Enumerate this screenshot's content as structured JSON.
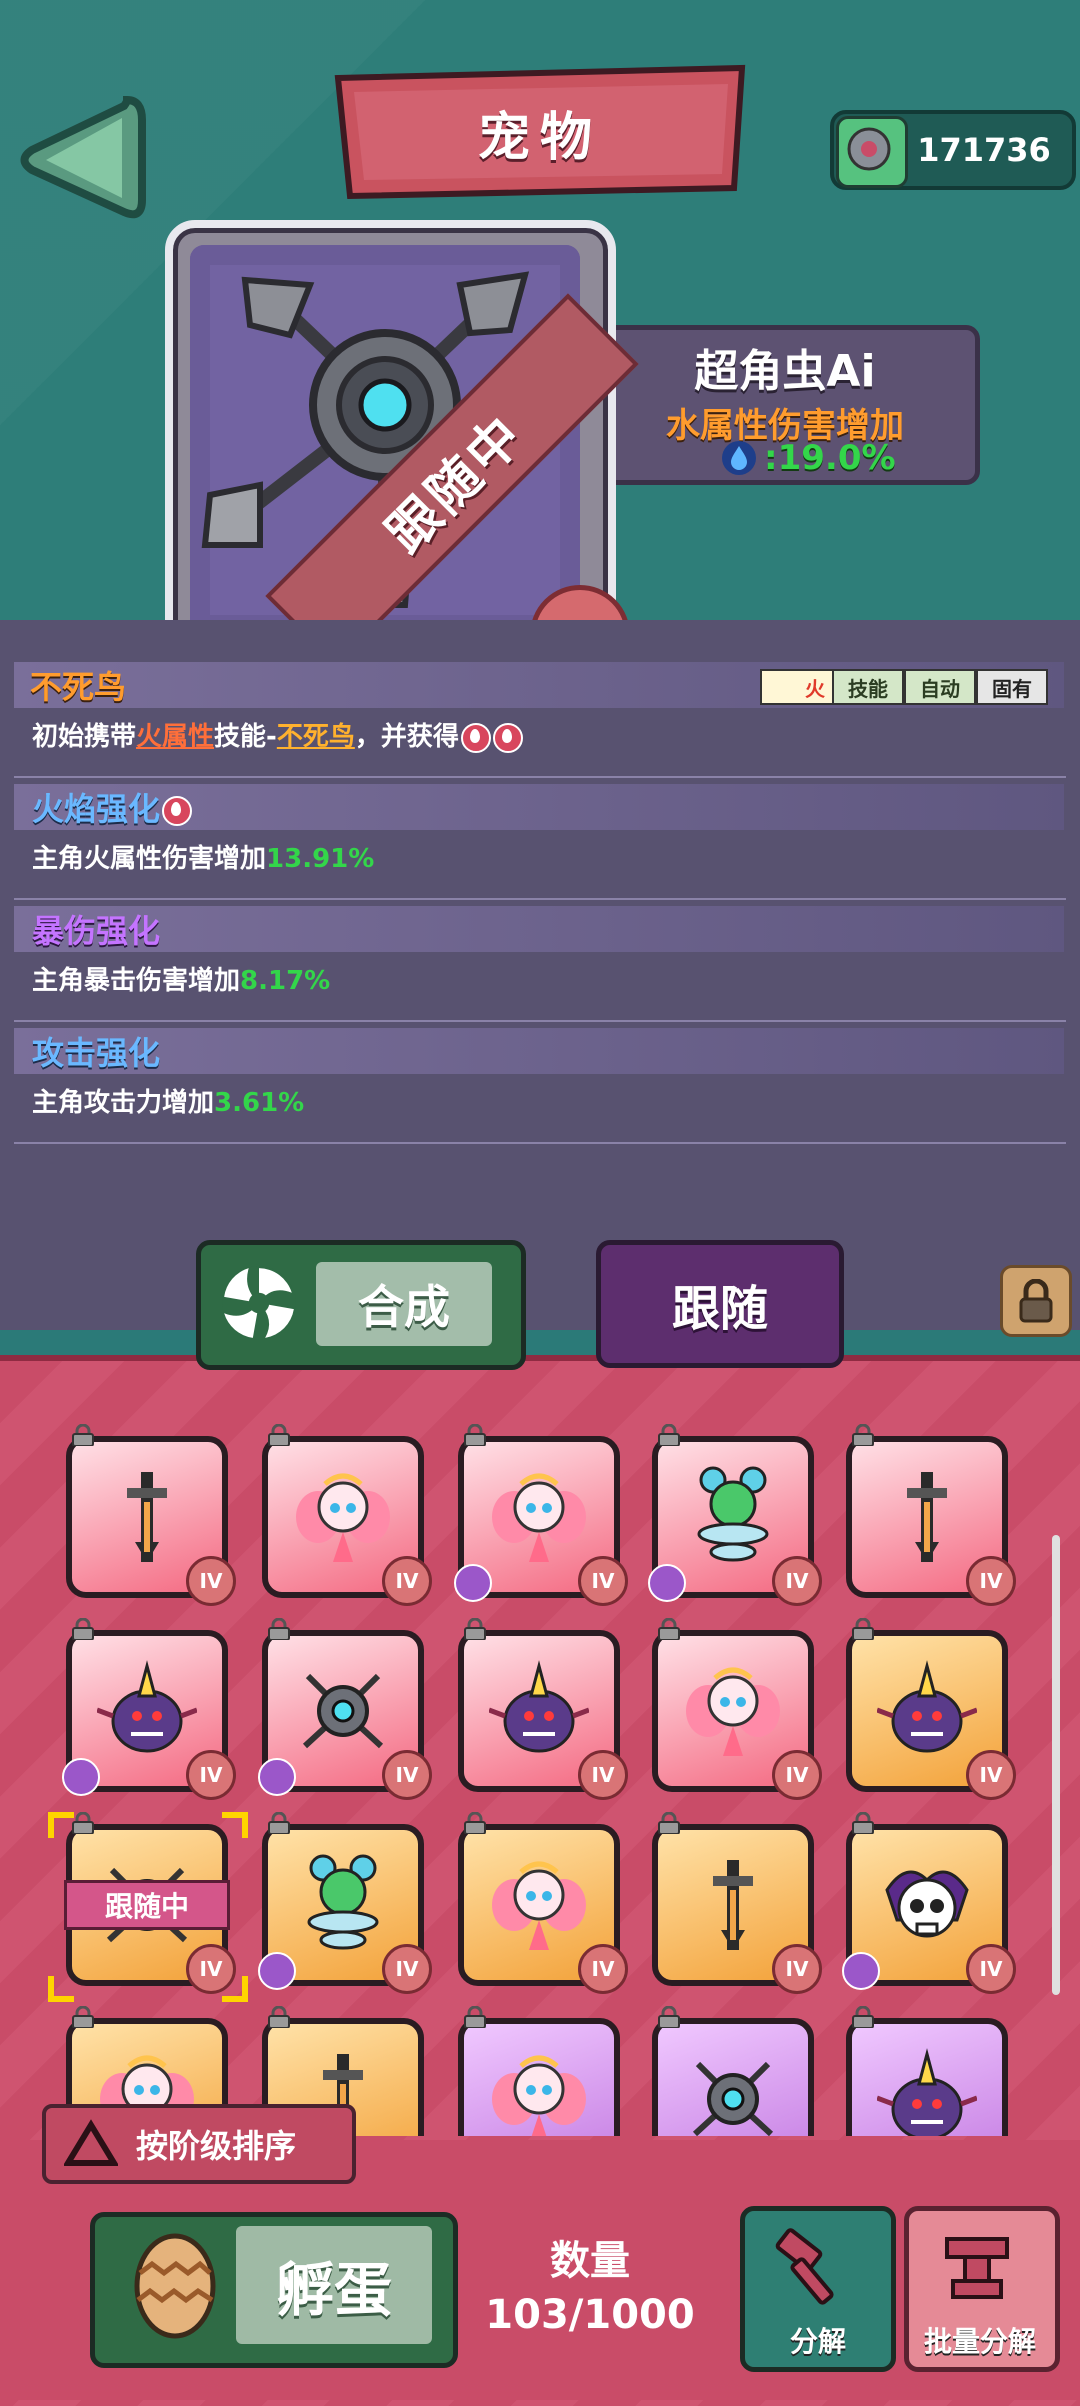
{
  "header": {
    "title": "宠物",
    "currency_value": "171736"
  },
  "pet": {
    "name": "超角虫Ai",
    "attribute": "水属性伤害增加",
    "bonus": ":19.0%",
    "follow_ribbon": "跟随中",
    "tier": "IV"
  },
  "skills": [
    {
      "title": "不死鸟",
      "desc_prefix": "初始携带",
      "desc_hl1": "火属性",
      "desc_mid": "技能-",
      "desc_hl2": "不死鸟",
      "desc_suffix": "，并获得"
    },
    {
      "title": "火焰强化",
      "desc": "主角火属性伤害增加",
      "value": "13.91%"
    },
    {
      "title": "暴伤强化",
      "desc": "主角暴击伤害增加",
      "value": "8.17%"
    },
    {
      "title": "攻击强化",
      "desc": "主角攻击力增加",
      "value": "3.61%"
    }
  ],
  "tags": [
    "火",
    "技能",
    "自动",
    "固有"
  ],
  "tabs": {
    "merge": "合成",
    "follow": "跟随"
  },
  "grid": {
    "level": "IV",
    "follow_tag": "跟随中",
    "slots": [
      {
        "pet": "sword-pet",
        "bg": "red",
        "elem": false
      },
      {
        "pet": "fairy-pet",
        "bg": "red",
        "elem": false
      },
      {
        "pet": "fairy-pet",
        "bg": "red",
        "elem": true
      },
      {
        "pet": "tornado-pet",
        "bg": "red",
        "elem": true
      },
      {
        "pet": "sword-pet",
        "bg": "red",
        "elem": false
      },
      {
        "pet": "horn-bug-pet",
        "bg": "red",
        "elem": true
      },
      {
        "pet": "orb-bug-pet",
        "bg": "red",
        "elem": true
      },
      {
        "pet": "horn-bug-pet",
        "bg": "red",
        "elem": false
      },
      {
        "pet": "fairy-pet",
        "bg": "red",
        "elem": false
      },
      {
        "pet": "horn-bug-pet",
        "bg": "orange",
        "elem": false
      },
      {
        "pet": "orb-bug-pet",
        "bg": "orange",
        "elem": false,
        "following": true
      },
      {
        "pet": "tornado-pet",
        "bg": "orange",
        "elem": true
      },
      {
        "pet": "fairy-pet",
        "bg": "orange",
        "elem": false
      },
      {
        "pet": "sword-pet",
        "bg": "orange",
        "elem": false
      },
      {
        "pet": "skull-pet",
        "bg": "orange",
        "elem": true
      },
      {
        "pet": "fairy-pet",
        "bg": "orange",
        "elem": false
      },
      {
        "pet": "sword-pet",
        "bg": "orange",
        "elem": false
      },
      {
        "pet": "fairy-pet",
        "bg": "purple",
        "elem": false
      },
      {
        "pet": "orb-bug-pet",
        "bg": "purple",
        "elem": false
      },
      {
        "pet": "horn-bug-pet",
        "bg": "purple",
        "elem": false
      }
    ]
  },
  "sort_label": "按阶级排序",
  "bottom": {
    "hatch": "孵蛋",
    "count_label": "数量",
    "count_value": "103/1000",
    "salvage": "分解",
    "bulk_salvage": "批量分解"
  }
}
